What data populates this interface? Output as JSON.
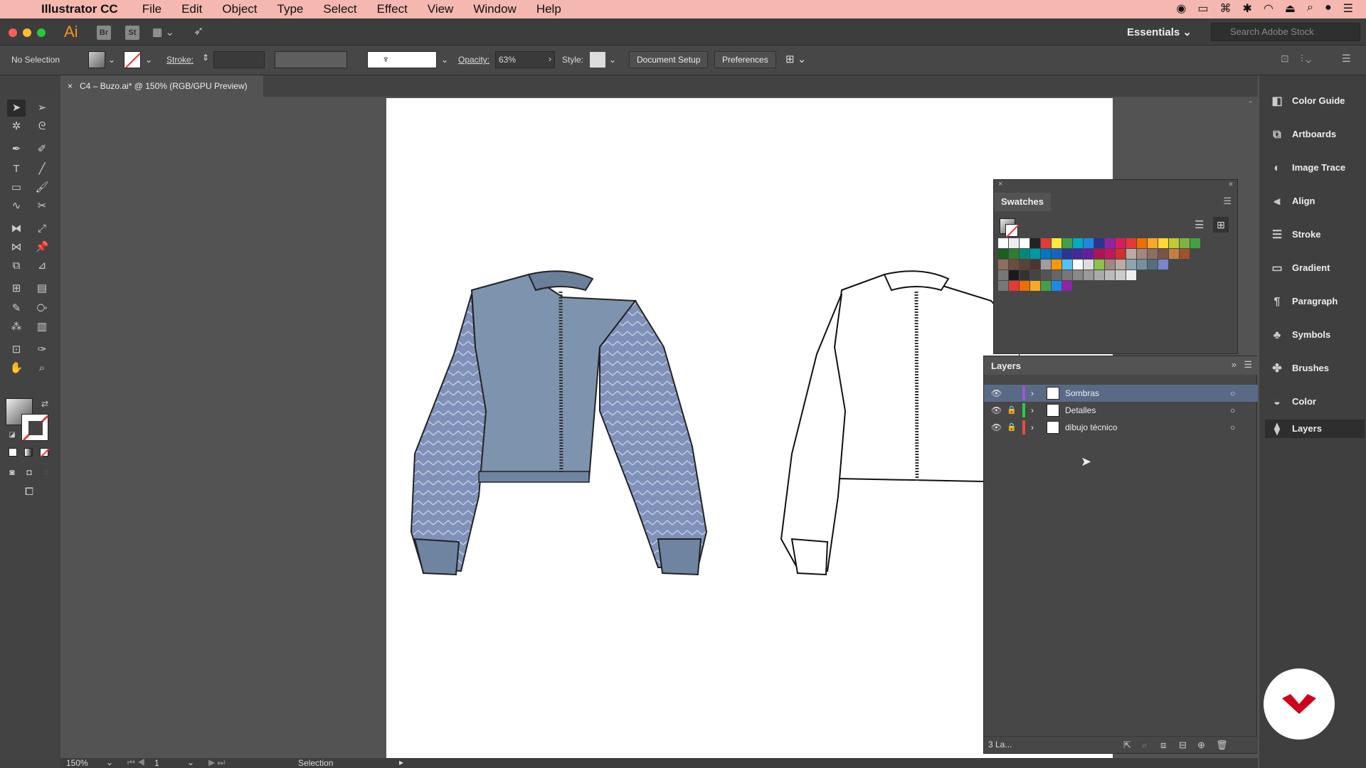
{
  "menubar": {
    "app": "Illustrator CC",
    "items": [
      "File",
      "Edit",
      "Object",
      "Type",
      "Select",
      "Effect",
      "View",
      "Window",
      "Help"
    ]
  },
  "appbar": {
    "logo": "Ai",
    "bridge": "Br",
    "stock": "St",
    "workspace": "Essentials",
    "search_placeholder": "Search Adobe Stock"
  },
  "controlbar": {
    "selection": "No Selection",
    "stroke_label": "Stroke:",
    "opacity_label": "Opacity:",
    "opacity_value": "63%",
    "style_label": "Style:",
    "doc_setup": "Document Setup",
    "preferences": "Preferences"
  },
  "tab": {
    "title": "C4 – Buzo.ai* @ 150% (RGB/GPU Preview)",
    "close": "×"
  },
  "swatches": {
    "title": "Swatches"
  },
  "layers": {
    "title": "Layers",
    "rows": [
      {
        "name": "Sombras",
        "color": "#9b59d6"
      },
      {
        "name": "Detalles",
        "color": "#2ecc40"
      },
      {
        "name": "dibujo técnico",
        "color": "#e74c3c"
      }
    ],
    "count": "3 La..."
  },
  "dock": {
    "items": [
      "Color Guide",
      "Artboards",
      "Image Trace",
      "Align",
      "Stroke",
      "Gradient",
      "Paragraph",
      "Symbols",
      "Brushes",
      "Color",
      "Layers"
    ]
  },
  "status": {
    "zoom": "150%",
    "artboard": "1",
    "mode": "Selection"
  },
  "colors": {
    "accent": "#f7941e",
    "menubar": "#f4b8b0",
    "jacket": "#7e93ad"
  }
}
